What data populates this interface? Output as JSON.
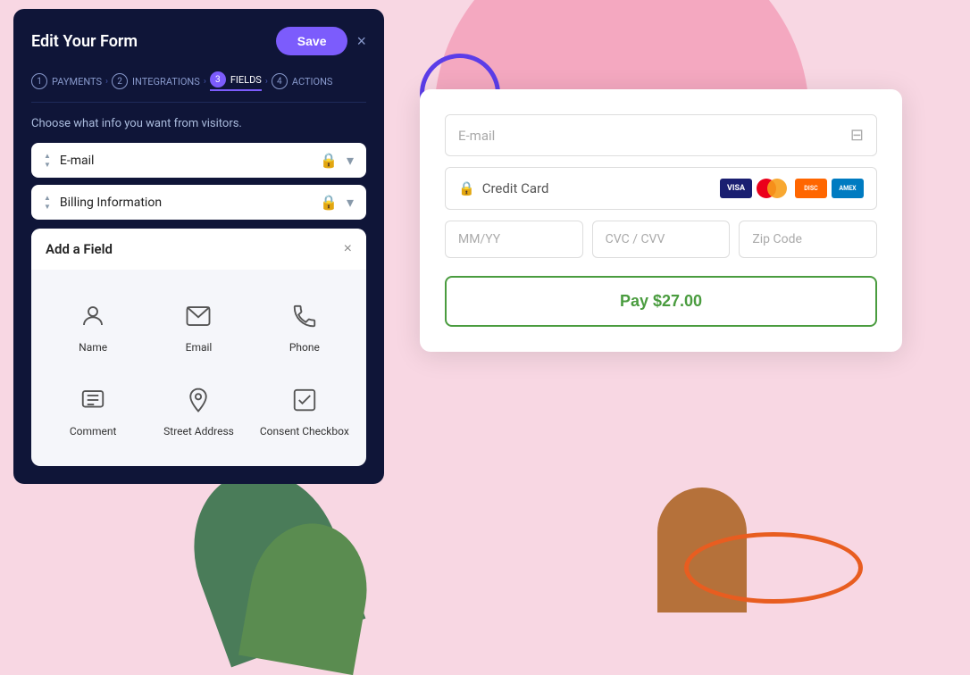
{
  "background": {
    "shapes": []
  },
  "leftPanel": {
    "title": "Edit Your Form",
    "saveLabel": "Save",
    "closeIcon": "×",
    "steps": [
      {
        "num": "1",
        "label": "PAYMENTS",
        "active": false
      },
      {
        "num": "2",
        "label": "INTEGRATIONS",
        "active": false
      },
      {
        "num": "3",
        "label": "FIELDS",
        "active": true
      },
      {
        "num": "4",
        "label": "ACTIONS",
        "active": false
      }
    ],
    "chooseText": "Choose what info you want from visitors.",
    "fields": [
      {
        "label": "E-mail",
        "locked": true
      },
      {
        "label": "Billing Information",
        "locked": true
      }
    ],
    "addFieldPanel": {
      "title": "Add a Field",
      "closeIcon": "×",
      "items": [
        {
          "id": "name",
          "label": "Name",
          "iconType": "person"
        },
        {
          "id": "email",
          "label": "Email",
          "iconType": "email"
        },
        {
          "id": "phone",
          "label": "Phone",
          "iconType": "phone"
        },
        {
          "id": "comment",
          "label": "Comment",
          "iconType": "comment"
        },
        {
          "id": "street-address",
          "label": "Street Address",
          "iconType": "location"
        },
        {
          "id": "consent-checkbox",
          "label": "Consent Checkbox",
          "iconType": "checkbox"
        }
      ]
    }
  },
  "rightCard": {
    "emailPlaceholder": "E-mail",
    "creditCardLabel": "Credit Card",
    "mmyyPlaceholder": "MM/YY",
    "cvvPlaceholder": "CVC / CVV",
    "zipPlaceholder": "Zip Code",
    "payLabel": "Pay $27.00",
    "cardLogos": [
      "VISA",
      "MC",
      "DISC",
      "AMEX"
    ]
  }
}
